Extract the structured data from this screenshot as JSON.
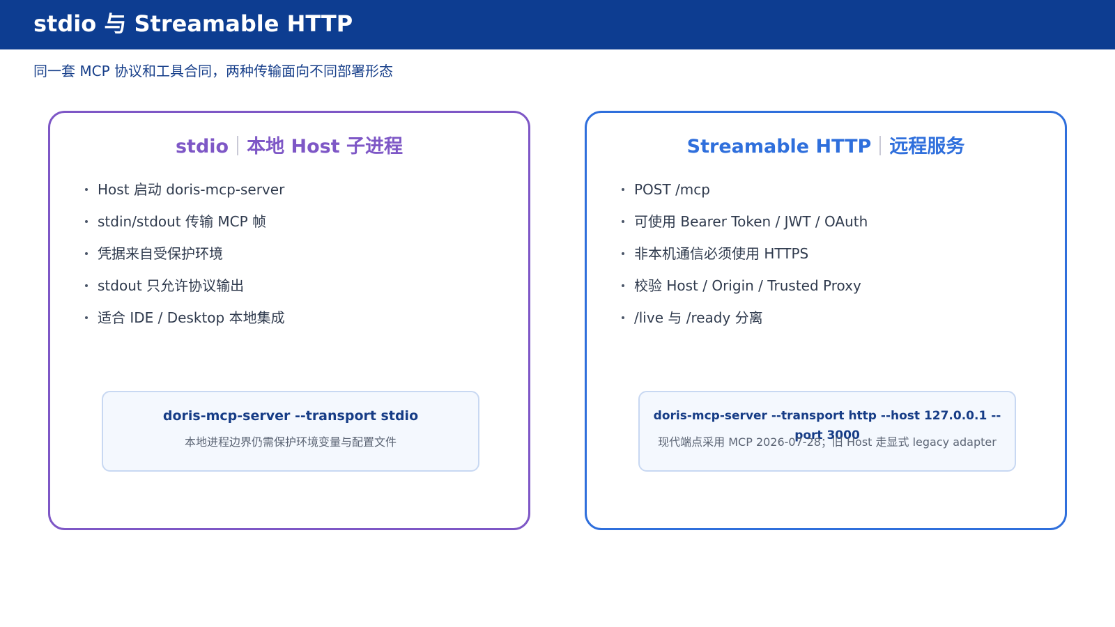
{
  "header": {
    "title": "stdio 与 Streamable HTTP"
  },
  "subtitle": "同一套 MCP 协议和工具合同，两种传输面向不同部署形态",
  "cards": [
    {
      "title_main": "stdio",
      "title_sub": "本地 Host 子进程",
      "items": [
        "Host 启动 doris-mcp-server",
        "stdin/stdout 传输 MCP 帧",
        "凭据来自受保护环境",
        "stdout 只允许协议输出",
        "适合 IDE / Desktop 本地集成"
      ],
      "command": "doris-mcp-server --transport stdio",
      "note": "本地进程边界仍需保护环境变量与配置文件",
      "accent_color": "#7e57c6"
    },
    {
      "title_main": "Streamable HTTP",
      "title_sub": "远程服务",
      "items": [
        "POST /mcp",
        "可使用 Bearer Token / JWT / OAuth",
        "非本机通信必须使用 HTTPS",
        "校验 Host / Origin / Trusted Proxy",
        "/live 与 /ready 分离"
      ],
      "command": "doris-mcp-server --transport http --host 127.0.0.1 --port 3000",
      "note": "现代端点采用 MCP 2026-07-28；旧 Host 走显式 legacy adapter",
      "accent_color": "#2f6fdc"
    }
  ],
  "colors": {
    "header_bg": "#0d3d91",
    "command_text": "#163c86",
    "command_box_bg": "#f4f8fe"
  }
}
